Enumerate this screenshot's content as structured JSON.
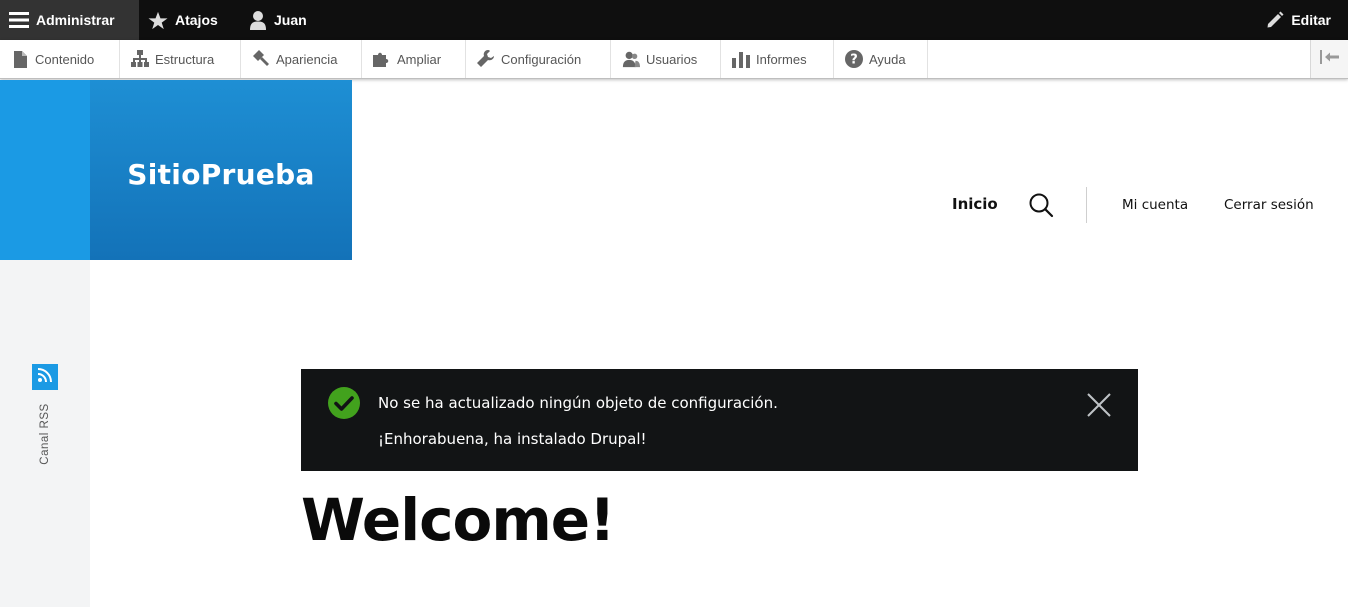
{
  "toolbar": {
    "manage_label": "Administrar",
    "shortcuts_label": "Atajos",
    "user_label": "Juan",
    "edit_label": "Editar"
  },
  "tray": {
    "items": [
      {
        "label": "Contenido",
        "icon": "file-icon"
      },
      {
        "label": "Estructura",
        "icon": "sitemap-icon"
      },
      {
        "label": "Apariencia",
        "icon": "paint-icon"
      },
      {
        "label": "Ampliar",
        "icon": "puzzle-icon"
      },
      {
        "label": "Configuración",
        "icon": "wrench-icon"
      },
      {
        "label": "Usuarios",
        "icon": "users-icon"
      },
      {
        "label": "Informes",
        "icon": "bar-chart-icon"
      },
      {
        "label": "Ayuda",
        "icon": "help-icon"
      }
    ]
  },
  "header": {
    "site_name": "SitioPrueba",
    "nav_home": "Inicio",
    "nav_account": "Mi cuenta",
    "nav_logout": "Cerrar sesión"
  },
  "social": {
    "rss_label": "Canal RSS"
  },
  "messages": {
    "line1": "No se ha actualizado ningún objeto de configuración.",
    "line2": "¡Enhorabuena, ha instalado Drupal!"
  },
  "main": {
    "title": "Welcome!"
  },
  "colors": {
    "brand_blue": "#1b9ae4",
    "status_green": "#42a21d",
    "toolbar_black": "#0f0f0f"
  }
}
